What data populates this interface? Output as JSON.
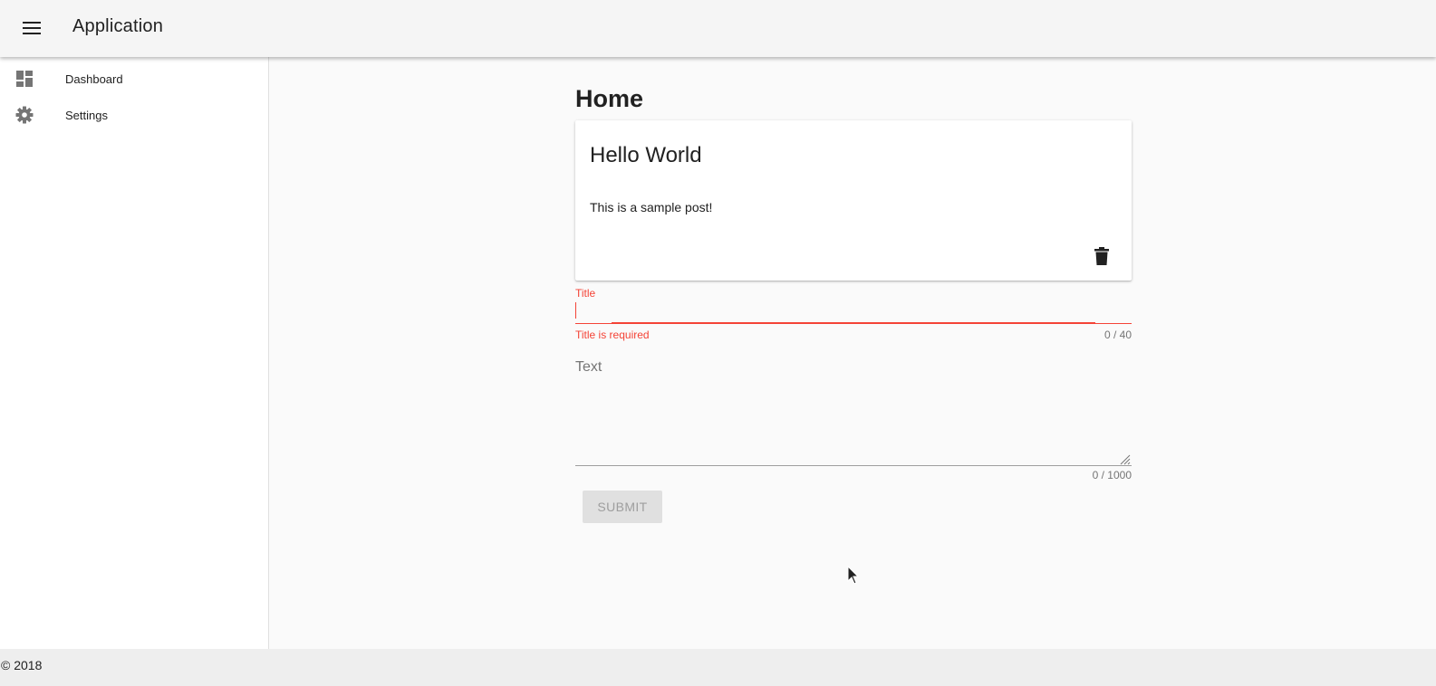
{
  "toolbar": {
    "menu_icon": "menu-icon",
    "title": "Application"
  },
  "sidenav": {
    "items": [
      {
        "label": "Dashboard",
        "icon": "dashboard-icon"
      },
      {
        "label": "Settings",
        "icon": "gear-icon"
      }
    ]
  },
  "main": {
    "page_title": "Home",
    "post": {
      "title": "Hello World",
      "body": "This is a sample post!",
      "delete_icon": "delete-icon"
    },
    "form": {
      "title_field": {
        "label": "Title",
        "value": "",
        "error": "Title is required",
        "counter": "0 / 40"
      },
      "text_field": {
        "placeholder": "Text",
        "value": "",
        "counter": "0 / 1000"
      },
      "submit_label": "SUBMIT"
    }
  },
  "footer": {
    "text": "© 2018"
  },
  "colors": {
    "error": "#f44336",
    "toolbar_bg": "#f5f5f5",
    "icon_gray": "#757575"
  }
}
